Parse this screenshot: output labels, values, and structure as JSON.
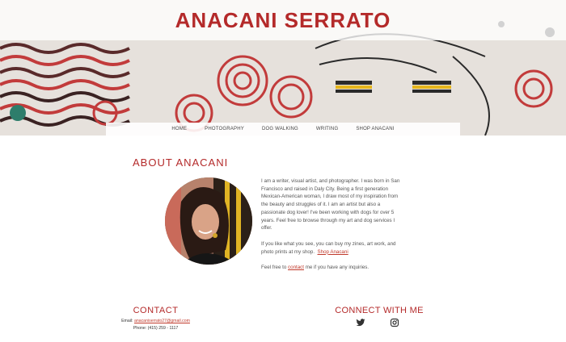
{
  "header": {
    "site_title": "ANACANI SERRATO"
  },
  "nav": {
    "items": [
      {
        "label": "HOME"
      },
      {
        "label": "PHOTOGRAPHY"
      },
      {
        "label": "DOG WALKING"
      },
      {
        "label": "WRITING"
      },
      {
        "label": "SHOP ANACANI"
      }
    ]
  },
  "about": {
    "heading": "ABOUT ANACANI",
    "p1": "I am a writer, visual artist, and photographer. I was born in San Francisco and raised in Daly City. Being a first generation Mexican-American woman, I draw most of my inspiration from the beauty and struggles of it. I am an artist but also a passionate dog lover! I've been working with dogs for over 5 years. Feel free to browse through my art and dog services I offer.",
    "p2_prefix": "If you like what you see, you can buy my zines, art work, and photo prints at my shop.",
    "p2_link": "Shop Anacani",
    "p3_prefix": "Feel free to ",
    "p3_link": "contact",
    "p3_suffix": " me if you have any inquiries."
  },
  "contact": {
    "heading": "CONTACT",
    "email_label": "Email:",
    "email": "anacaniserrato27@gmail.com",
    "phone": "Phone: (415) 259 - 1117"
  },
  "connect": {
    "heading": "CONNECT WITH ME",
    "icons": [
      "twitter-icon",
      "instagram-icon"
    ]
  },
  "colors": {
    "accent": "#b42a2a",
    "link": "#c0392b"
  }
}
